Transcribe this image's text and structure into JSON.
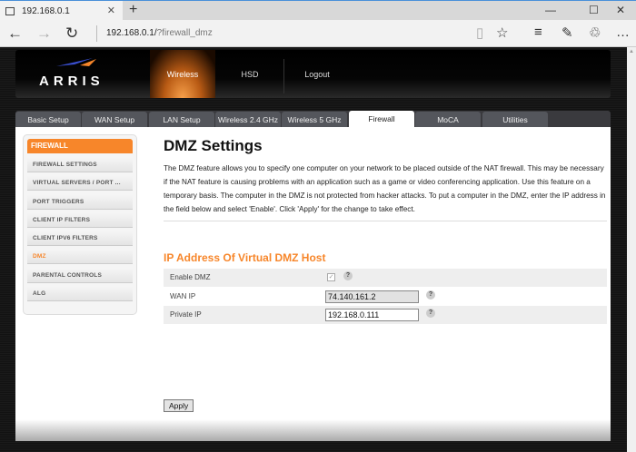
{
  "browser": {
    "tab_title": "192.168.0.1",
    "url_host": "192.168.0.1/",
    "url_path": "?firewall_dmz"
  },
  "header": {
    "logo": "ARRIS",
    "nav": [
      "Wireless",
      "HSD",
      "Logout"
    ]
  },
  "tabs": [
    "Basic Setup",
    "WAN Setup",
    "LAN Setup",
    "Wireless 2.4 GHz",
    "Wireless 5 GHz",
    "Firewall",
    "MoCA",
    "Utilities"
  ],
  "sidebar": {
    "title": "FIREWALL",
    "items": [
      "FIREWALL SETTINGS",
      "VIRTUAL SERVERS / PORT ...",
      "PORT TRIGGERS",
      "CLIENT IP FILTERS",
      "CLIENT IPV6 FILTERS",
      "DMZ",
      "PARENTAL CONTROLS",
      "ALG"
    ]
  },
  "main": {
    "title": "DMZ Settings",
    "description": "The DMZ feature allows you to specify one computer on your network to be placed outside of the NAT firewall. This may be necessary if the NAT feature is causing problems with an application such as a game or video conferencing application. Use this feature on a temporary basis. The computer in the DMZ is not protected from hacker attacks. To put a computer in the DMZ, enter the IP address in the field below and select 'Enable'. Click 'Apply' for the change to take effect.",
    "section_title": "IP Address Of Virtual DMZ Host",
    "enable_label": "Enable DMZ",
    "wan_label": "WAN IP",
    "wan_value": "74.140.161.2",
    "private_label": "Private IP",
    "private_value": "192.168.0.111",
    "help": "?",
    "apply": "Apply"
  },
  "colors": {
    "accent": "#f7862a"
  }
}
